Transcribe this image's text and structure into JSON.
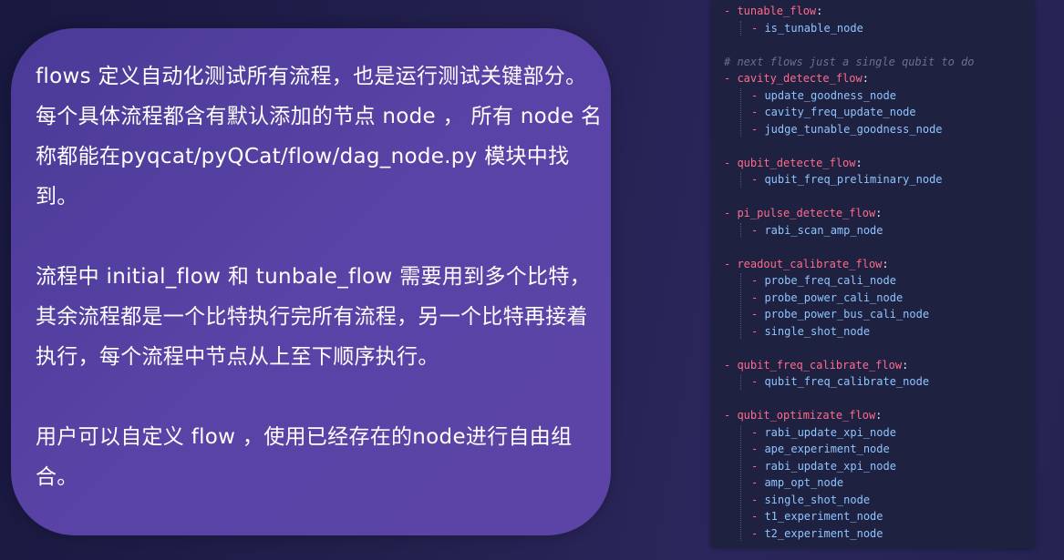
{
  "text_card": {
    "paragraphs": [
      "flows 定义自动化测试所有流程，也是运行测试关键部分。每个具体流程都含有默认添加的节点 node ， 所有 node 名 称都能在pyqcat/pyQCat/flow/dag_node.py 模块中找到。",
      "流程中 initial_flow 和 tunbale_flow 需要用到多个比特，其余流程都是一个比特执行完所有流程，另一个比特再接着执行，每个流程中节点从上至下顺序执行。",
      "用户可以自定义 flow ，使用已经存在的node进行自由组合。"
    ]
  },
  "code": {
    "flows": [
      {
        "name": "tunable_flow",
        "nodes": [
          "is_tunable_node"
        ]
      },
      {
        "comment": "# next flows just a single qubit to do"
      },
      {
        "name": "cavity_detecte_flow",
        "nodes": [
          "update_goodness_node",
          "cavity_freq_update_node",
          "judge_tunable_goodness_node"
        ]
      },
      {
        "name": "qubit_detecte_flow",
        "nodes": [
          "qubit_freq_preliminary_node"
        ]
      },
      {
        "name": "pi_pulse_detecte_flow",
        "nodes": [
          "rabi_scan_amp_node"
        ]
      },
      {
        "name": "readout_calibrate_flow",
        "nodes": [
          "probe_freq_cali_node",
          "probe_power_cali_node",
          "probe_power_bus_cali_node",
          "single_shot_node"
        ]
      },
      {
        "name": "qubit_freq_calibrate_flow",
        "nodes": [
          "qubit_freq_calibrate_node"
        ]
      },
      {
        "name": "qubit_optimizate_flow",
        "nodes": [
          "rabi_update_xpi_node",
          "ape_experiment_node",
          "rabi_update_xpi_node",
          "amp_opt_node",
          "single_shot_node",
          "t1_experiment_node",
          "t2_experiment_node"
        ]
      }
    ]
  },
  "colors": {
    "background": "#1f1d47",
    "card": "#5641a1",
    "code_panel": "#1f2140",
    "yaml_key": "#ff6b8b",
    "yaml_value": "#8ec5ff",
    "yaml_comment": "#6b6f95"
  }
}
